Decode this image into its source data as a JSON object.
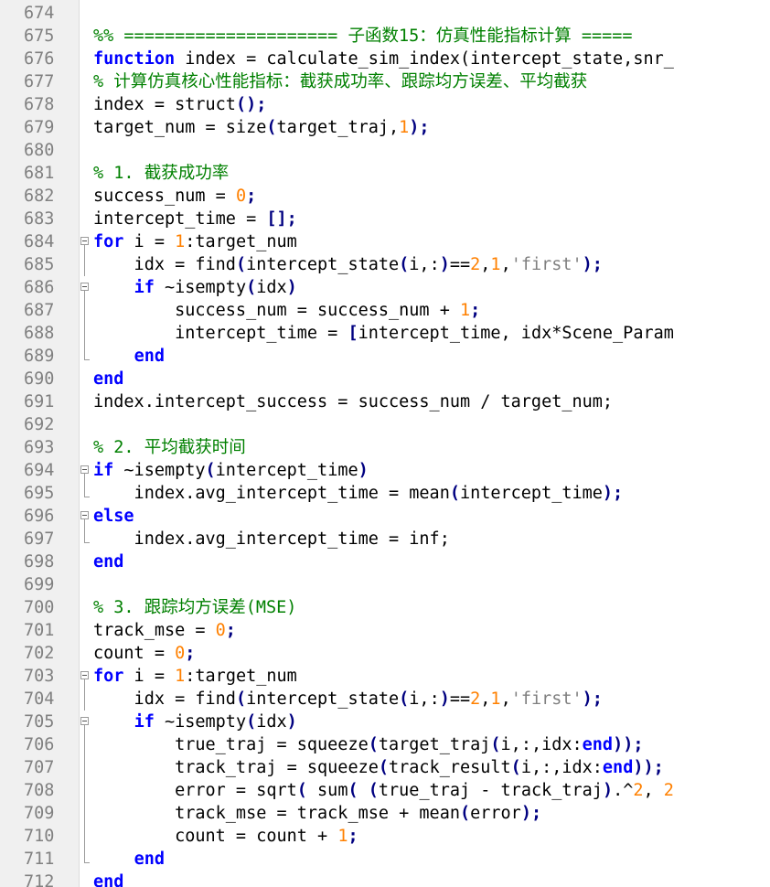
{
  "colors": {
    "keyword": "#0000ff",
    "comment": "#008000",
    "number": "#ff8000",
    "string": "#808080",
    "operator": "#000080",
    "line_number": "#808080",
    "gutter_background": "#f0f0f0"
  },
  "lines": [
    {
      "n": "674",
      "fold": "",
      "tokens": []
    },
    {
      "n": "675",
      "fold": "",
      "tokens": [
        {
          "t": "cm",
          "v": "%% ===================== 子函数15：仿真性能指标计算 ====="
        }
      ]
    },
    {
      "n": "676",
      "fold": "",
      "tokens": [
        {
          "t": "kw",
          "v": "function"
        },
        {
          "t": "",
          "v": " index = calculate_sim_index(intercept_state,snr_"
        }
      ]
    },
    {
      "n": "677",
      "fold": "",
      "tokens": [
        {
          "t": "cm",
          "v": "% 计算仿真核心性能指标：截获成功率、跟踪均方误差、平均截获"
        }
      ]
    },
    {
      "n": "678",
      "fold": "",
      "tokens": [
        {
          "t": "",
          "v": "index = struct"
        },
        {
          "t": "op",
          "v": "();"
        }
      ]
    },
    {
      "n": "679",
      "fold": "",
      "tokens": [
        {
          "t": "",
          "v": "target_num = size"
        },
        {
          "t": "op",
          "v": "("
        },
        {
          "t": "",
          "v": "target_traj,"
        },
        {
          "t": "num",
          "v": "1"
        },
        {
          "t": "op",
          "v": ");"
        }
      ]
    },
    {
      "n": "680",
      "fold": "",
      "tokens": []
    },
    {
      "n": "681",
      "fold": "",
      "tokens": [
        {
          "t": "cm",
          "v": "% 1. 截获成功率"
        }
      ]
    },
    {
      "n": "682",
      "fold": "",
      "tokens": [
        {
          "t": "",
          "v": "success_num = "
        },
        {
          "t": "num",
          "v": "0"
        },
        {
          "t": "op",
          "v": ";"
        }
      ]
    },
    {
      "n": "683",
      "fold": "",
      "tokens": [
        {
          "t": "",
          "v": "intercept_time = "
        },
        {
          "t": "op",
          "v": "[];"
        }
      ]
    },
    {
      "n": "684",
      "fold": "open",
      "tokens": [
        {
          "t": "kw",
          "v": "for"
        },
        {
          "t": "",
          "v": " i = "
        },
        {
          "t": "num",
          "v": "1"
        },
        {
          "t": "",
          "v": ":target_num"
        }
      ]
    },
    {
      "n": "685",
      "fold": "line",
      "tokens": [
        {
          "t": "",
          "v": "    idx = find"
        },
        {
          "t": "op",
          "v": "("
        },
        {
          "t": "",
          "v": "intercept_state"
        },
        {
          "t": "op",
          "v": "("
        },
        {
          "t": "",
          "v": "i,:"
        },
        {
          "t": "op",
          "v": ")"
        },
        {
          "t": "",
          "v": "=="
        },
        {
          "t": "num",
          "v": "2"
        },
        {
          "t": "",
          "v": ","
        },
        {
          "t": "num",
          "v": "1"
        },
        {
          "t": "",
          "v": ","
        },
        {
          "t": "str",
          "v": "'first'"
        },
        {
          "t": "op",
          "v": ");"
        }
      ]
    },
    {
      "n": "686",
      "fold": "open",
      "tokens": [
        {
          "t": "",
          "v": "    "
        },
        {
          "t": "kw",
          "v": "if"
        },
        {
          "t": "",
          "v": " ~isempty"
        },
        {
          "t": "op",
          "v": "("
        },
        {
          "t": "",
          "v": "idx"
        },
        {
          "t": "op",
          "v": ")"
        }
      ]
    },
    {
      "n": "687",
      "fold": "line",
      "tokens": [
        {
          "t": "",
          "v": "        success_num = success_num + "
        },
        {
          "t": "num",
          "v": "1"
        },
        {
          "t": "op",
          "v": ";"
        }
      ]
    },
    {
      "n": "688",
      "fold": "line",
      "tokens": [
        {
          "t": "",
          "v": "        intercept_time = "
        },
        {
          "t": "op",
          "v": "["
        },
        {
          "t": "",
          "v": "intercept_time, idx*Scene_Param"
        }
      ]
    },
    {
      "n": "689",
      "fold": "end",
      "tokens": [
        {
          "t": "",
          "v": "    "
        },
        {
          "t": "kw",
          "v": "end"
        }
      ]
    },
    {
      "n": "690",
      "fold": "",
      "tokens": [
        {
          "t": "kw",
          "v": "end"
        }
      ]
    },
    {
      "n": "691",
      "fold": "",
      "tokens": [
        {
          "t": "",
          "v": "index.intercept_success = success_num / target_num;"
        }
      ]
    },
    {
      "n": "692",
      "fold": "",
      "tokens": []
    },
    {
      "n": "693",
      "fold": "",
      "tokens": [
        {
          "t": "cm",
          "v": "% 2. 平均截获时间"
        }
      ]
    },
    {
      "n": "694",
      "fold": "open",
      "tokens": [
        {
          "t": "kw",
          "v": "if"
        },
        {
          "t": "",
          "v": " ~isempty"
        },
        {
          "t": "op",
          "v": "("
        },
        {
          "t": "",
          "v": "intercept_time"
        },
        {
          "t": "op",
          "v": ")"
        }
      ]
    },
    {
      "n": "695",
      "fold": "end",
      "tokens": [
        {
          "t": "",
          "v": "    index.avg_intercept_time = mean"
        },
        {
          "t": "op",
          "v": "("
        },
        {
          "t": "",
          "v": "intercept_time"
        },
        {
          "t": "op",
          "v": ");"
        }
      ]
    },
    {
      "n": "696",
      "fold": "open",
      "tokens": [
        {
          "t": "kw",
          "v": "else"
        }
      ]
    },
    {
      "n": "697",
      "fold": "end",
      "tokens": [
        {
          "t": "",
          "v": "    index.avg_intercept_time = inf;"
        }
      ]
    },
    {
      "n": "698",
      "fold": "",
      "tokens": [
        {
          "t": "kw",
          "v": "end"
        }
      ]
    },
    {
      "n": "699",
      "fold": "",
      "tokens": []
    },
    {
      "n": "700",
      "fold": "",
      "tokens": [
        {
          "t": "cm",
          "v": "% 3. 跟踪均方误差(MSE)"
        }
      ]
    },
    {
      "n": "701",
      "fold": "",
      "tokens": [
        {
          "t": "",
          "v": "track_mse = "
        },
        {
          "t": "num",
          "v": "0"
        },
        {
          "t": "op",
          "v": ";"
        }
      ]
    },
    {
      "n": "702",
      "fold": "",
      "tokens": [
        {
          "t": "",
          "v": "count = "
        },
        {
          "t": "num",
          "v": "0"
        },
        {
          "t": "op",
          "v": ";"
        }
      ]
    },
    {
      "n": "703",
      "fold": "open",
      "tokens": [
        {
          "t": "kw",
          "v": "for"
        },
        {
          "t": "",
          "v": " i = "
        },
        {
          "t": "num",
          "v": "1"
        },
        {
          "t": "",
          "v": ":target_num"
        }
      ]
    },
    {
      "n": "704",
      "fold": "line",
      "tokens": [
        {
          "t": "",
          "v": "    idx = find"
        },
        {
          "t": "op",
          "v": "("
        },
        {
          "t": "",
          "v": "intercept_state"
        },
        {
          "t": "op",
          "v": "("
        },
        {
          "t": "",
          "v": "i,:"
        },
        {
          "t": "op",
          "v": ")"
        },
        {
          "t": "",
          "v": "=="
        },
        {
          "t": "num",
          "v": "2"
        },
        {
          "t": "",
          "v": ","
        },
        {
          "t": "num",
          "v": "1"
        },
        {
          "t": "",
          "v": ","
        },
        {
          "t": "str",
          "v": "'first'"
        },
        {
          "t": "op",
          "v": ");"
        }
      ]
    },
    {
      "n": "705",
      "fold": "open",
      "tokens": [
        {
          "t": "",
          "v": "    "
        },
        {
          "t": "kw",
          "v": "if"
        },
        {
          "t": "",
          "v": " ~isempty"
        },
        {
          "t": "op",
          "v": "("
        },
        {
          "t": "",
          "v": "idx"
        },
        {
          "t": "op",
          "v": ")"
        }
      ]
    },
    {
      "n": "706",
      "fold": "line",
      "tokens": [
        {
          "t": "",
          "v": "        true_traj = squeeze"
        },
        {
          "t": "op",
          "v": "("
        },
        {
          "t": "",
          "v": "target_traj"
        },
        {
          "t": "op",
          "v": "("
        },
        {
          "t": "",
          "v": "i,:,idx:"
        },
        {
          "t": "kw",
          "v": "end"
        },
        {
          "t": "op",
          "v": "));"
        }
      ]
    },
    {
      "n": "707",
      "fold": "line",
      "tokens": [
        {
          "t": "",
          "v": "        track_traj = squeeze"
        },
        {
          "t": "op",
          "v": "("
        },
        {
          "t": "",
          "v": "track_result"
        },
        {
          "t": "op",
          "v": "("
        },
        {
          "t": "",
          "v": "i,:,idx:"
        },
        {
          "t": "kw",
          "v": "end"
        },
        {
          "t": "op",
          "v": "));"
        }
      ]
    },
    {
      "n": "708",
      "fold": "line",
      "tokens": [
        {
          "t": "",
          "v": "        error = sqrt"
        },
        {
          "t": "op",
          "v": "("
        },
        {
          "t": "",
          "v": " sum"
        },
        {
          "t": "op",
          "v": "("
        },
        {
          "t": "",
          "v": " "
        },
        {
          "t": "op",
          "v": "("
        },
        {
          "t": "",
          "v": "true_traj - track_traj"
        },
        {
          "t": "op",
          "v": ")"
        },
        {
          "t": "",
          "v": ".^"
        },
        {
          "t": "num",
          "v": "2"
        },
        {
          "t": "",
          "v": ", "
        },
        {
          "t": "num",
          "v": "2"
        }
      ]
    },
    {
      "n": "709",
      "fold": "line",
      "tokens": [
        {
          "t": "",
          "v": "        track_mse = track_mse + mean"
        },
        {
          "t": "op",
          "v": "("
        },
        {
          "t": "",
          "v": "error"
        },
        {
          "t": "op",
          "v": ");"
        }
      ]
    },
    {
      "n": "710",
      "fold": "line",
      "tokens": [
        {
          "t": "",
          "v": "        count = count + "
        },
        {
          "t": "num",
          "v": "1"
        },
        {
          "t": "op",
          "v": ";"
        }
      ]
    },
    {
      "n": "711",
      "fold": "end",
      "tokens": [
        {
          "t": "",
          "v": "    "
        },
        {
          "t": "kw",
          "v": "end"
        }
      ]
    },
    {
      "n": "712",
      "fold": "",
      "tokens": [
        {
          "t": "kw",
          "v": "end"
        }
      ]
    }
  ]
}
